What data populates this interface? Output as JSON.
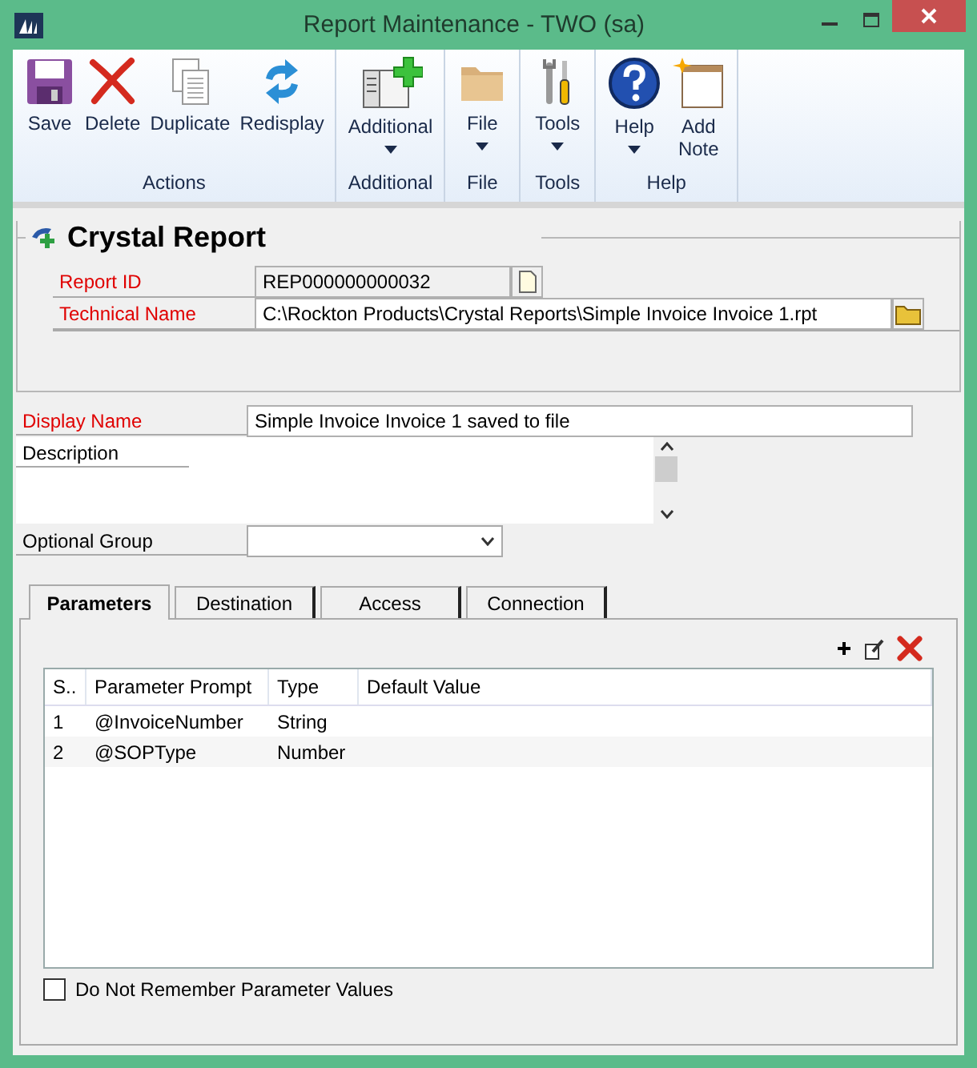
{
  "window": {
    "title": "Report Maintenance  -  TWO (sa)"
  },
  "ribbon": {
    "groups": [
      {
        "label": "Actions",
        "buttons": [
          {
            "label": "Save",
            "dropdown": false
          },
          {
            "label": "Delete",
            "dropdown": false
          },
          {
            "label": "Duplicate",
            "dropdown": false
          },
          {
            "label": "Redisplay",
            "dropdown": false
          }
        ]
      },
      {
        "label": "Additional",
        "buttons": [
          {
            "label": "Additional",
            "dropdown": true
          }
        ]
      },
      {
        "label": "File",
        "buttons": [
          {
            "label": "File",
            "dropdown": true
          }
        ]
      },
      {
        "label": "Tools",
        "buttons": [
          {
            "label": "Tools",
            "dropdown": true
          }
        ]
      },
      {
        "label": "Help",
        "buttons": [
          {
            "label": "Help",
            "dropdown": true
          },
          {
            "label": "Add Note",
            "dropdown": false
          }
        ]
      }
    ]
  },
  "header": {
    "title": "Crystal Report",
    "fields": [
      {
        "label": "Report ID",
        "value": "REP000000000032",
        "required": true
      },
      {
        "label": "Technical Name",
        "value": "C:\\Rockton Products\\Crystal Reports\\Simple Invoice Invoice 1.rpt",
        "required": true
      }
    ]
  },
  "fields": [
    {
      "kind": "text",
      "label": "Display Name",
      "value": "Simple Invoice Invoice 1 saved to file",
      "required": true
    },
    {
      "kind": "memo",
      "label": "Description",
      "required": false
    },
    {
      "kind": "dropdown",
      "label": "Optional Group",
      "required": false
    }
  ],
  "tabs": [
    {
      "label": "Parameters",
      "selected": true
    },
    {
      "label": "Destination",
      "selected": false
    },
    {
      "label": "Access",
      "selected": false
    },
    {
      "label": "Connection",
      "selected": false
    }
  ],
  "table": {
    "columns": [
      "S..",
      "Parameter Prompt",
      "Type",
      "Default Value"
    ],
    "rows": [
      [
        "1",
        "@InvoiceNumber",
        "String",
        ""
      ],
      [
        "2",
        "@SOPType",
        "Number",
        ""
      ]
    ]
  },
  "checkbox": {
    "label": "Do Not Remember Parameter Values",
    "checked": false
  }
}
